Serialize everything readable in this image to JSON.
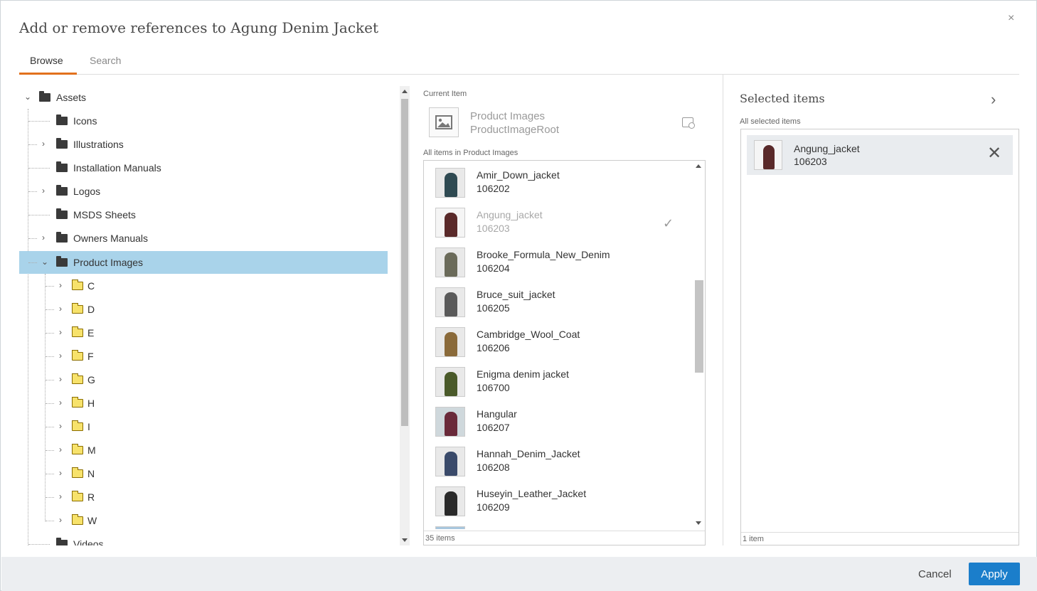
{
  "dialog": {
    "title": "Add or remove references to Agung Denim Jacket",
    "close_label": "×"
  },
  "tabs": [
    {
      "label": "Browse"
    },
    {
      "label": "Search"
    }
  ],
  "tree": {
    "root": "Assets",
    "items": [
      {
        "label": "Icons",
        "expandable": false
      },
      {
        "label": "Illustrations",
        "expandable": true
      },
      {
        "label": "Installation Manuals",
        "expandable": false
      },
      {
        "label": "Logos",
        "expandable": true
      },
      {
        "label": "MSDS Sheets",
        "expandable": false
      },
      {
        "label": "Owners Manuals",
        "expandable": true
      },
      {
        "label": "Product Images",
        "expandable": true,
        "selected": true
      }
    ],
    "sub_items": [
      "C",
      "D",
      "E",
      "F",
      "G",
      "H",
      "I",
      "M",
      "N",
      "R",
      "W"
    ],
    "last_item": "Videos"
  },
  "current": {
    "label": "Current Item",
    "name": "Product Images",
    "type": "ProductImageRoot"
  },
  "list": {
    "label": "All items in Product Images",
    "items": [
      {
        "name": "Amir_Down_jacket",
        "code": "106202",
        "color": "#2f4a52"
      },
      {
        "name": "Angung_jacket",
        "code": "106203",
        "color": "#5a2a2a",
        "selected": true
      },
      {
        "name": "Brooke_Formula_New_Denim",
        "code": "106204",
        "color": "#6b6b5a"
      },
      {
        "name": "Bruce_suit_jacket",
        "code": "106205",
        "color": "#5a5a5a"
      },
      {
        "name": "Cambridge_Wool_Coat",
        "code": "106206",
        "color": "#8a6a3a"
      },
      {
        "name": "Enigma denim jacket",
        "code": "106700",
        "color": "#4a5a2a"
      },
      {
        "name": "Hangular",
        "code": "106207",
        "color": "#6a2a3a"
      },
      {
        "name": "Hannah_Denim_Jacket",
        "code": "106208",
        "color": "#3a4a6a"
      },
      {
        "name": "Huseyin_Leather_Jacket",
        "code": "106209",
        "color": "#2a2a2a"
      }
    ],
    "footer": "35 items",
    "check_mark": "✓"
  },
  "selected": {
    "title": "Selected items",
    "label": "All selected items",
    "items": [
      {
        "name": "Angung_jacket",
        "code": "106203"
      }
    ],
    "footer": "1 item",
    "remove_label": "✕"
  },
  "buttons": {
    "cancel": "Cancel",
    "apply": "Apply"
  },
  "colors": {
    "accent": "#e2711d",
    "primary": "#1b7ecb",
    "tree_selected": "#a9d3ea"
  }
}
